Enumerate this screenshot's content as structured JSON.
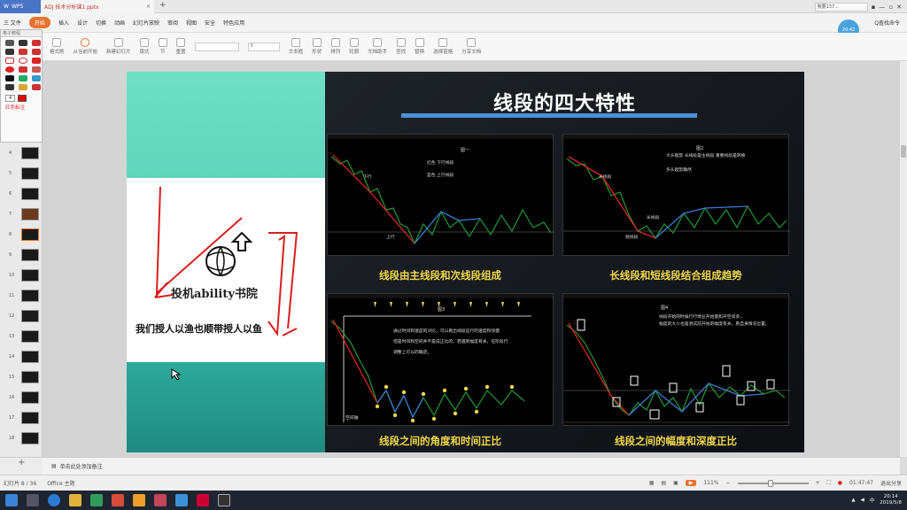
{
  "titlebar": {
    "app_name": "WPS",
    "doc_tab": "ADJ 技术分析课1.pptx",
    "user": "我要137...",
    "controls": [
      "▪",
      "—",
      "▫",
      "✕"
    ]
  },
  "menu": {
    "file": "三 文件",
    "items": [
      "开始",
      "插入",
      "设计",
      "切换",
      "动画",
      "幻灯片放映",
      "审阅",
      "视图",
      "安全",
      "特色应用"
    ],
    "active": "开始",
    "search": "Q查找命令",
    "avatar_time": "20:42"
  },
  "ribbon": {
    "buttons": [
      "格式刷",
      "从当前开始",
      "新建幻灯片",
      "版式",
      "节",
      "重置",
      "文本框",
      "形状",
      "排列",
      "轮廓",
      "文档助手",
      "查找",
      "替换",
      "选择窗格",
      "分享文档"
    ],
    "font_size": "0"
  },
  "palette": {
    "title": "格子教程",
    "footer": "红色标注",
    "number": "4"
  },
  "thumbnails": [
    {
      "n": "4"
    },
    {
      "n": "5"
    },
    {
      "n": "6"
    },
    {
      "n": "7"
    },
    {
      "n": "8"
    },
    {
      "n": "9"
    },
    {
      "n": "10"
    },
    {
      "n": "11"
    },
    {
      "n": "12"
    },
    {
      "n": "13"
    },
    {
      "n": "14"
    },
    {
      "n": "15"
    },
    {
      "n": "16"
    },
    {
      "n": "17"
    },
    {
      "n": "18"
    }
  ],
  "slide": {
    "title": "线段的四大特性",
    "logo_text": "投机ability书院",
    "slogan": "我们授人以渔也顺带授人以鱼",
    "panels": [
      {
        "label": "图一",
        "notes": [
          "红色 下行线段",
          "蓝色 上行线段"
        ],
        "tags": [
          "下行",
          "上行"
        ],
        "caption": "线段由主线段和次线段组成"
      },
      {
        "label": "图2",
        "notes": [
          "大头趋势 长线段是主线段  重要线段是转换",
          "多头趋势确然"
        ],
        "tags": [
          "长线段",
          "短线段",
          "长线段"
        ],
        "caption": "长线段和短线段结合组成趋势"
      },
      {
        "label": "图3",
        "notes": [
          "通过时间和速度的对比，可以看出线段运行的速度和快慢",
          "但是时间和空间并不是成正比的，若遇到幅度有关，在阶段行",
          "调整上可以的确定。"
        ],
        "tags": [
          "空间轴"
        ],
        "caption": "线段之间的角度和时间正比"
      },
      {
        "label": "图4",
        "notes": [
          "线段开始的时候行行情业开始量和开空间多，",
          "幅度的大小也是测试前开始的幅度有关，看自身情况位置。"
        ],
        "tags": [],
        "caption": "线段之间的幅度和深度正比"
      }
    ]
  },
  "notes_bar": {
    "placeholder": "单击此处添加备注"
  },
  "status": {
    "slide_info": "幻灯片 8 / 36",
    "theme": "Office 主题",
    "zoom": "111%",
    "timer": "01:47:47",
    "exit": "退出分享"
  },
  "taskbar": {
    "time": "20:14",
    "date": "2019/5/8"
  }
}
